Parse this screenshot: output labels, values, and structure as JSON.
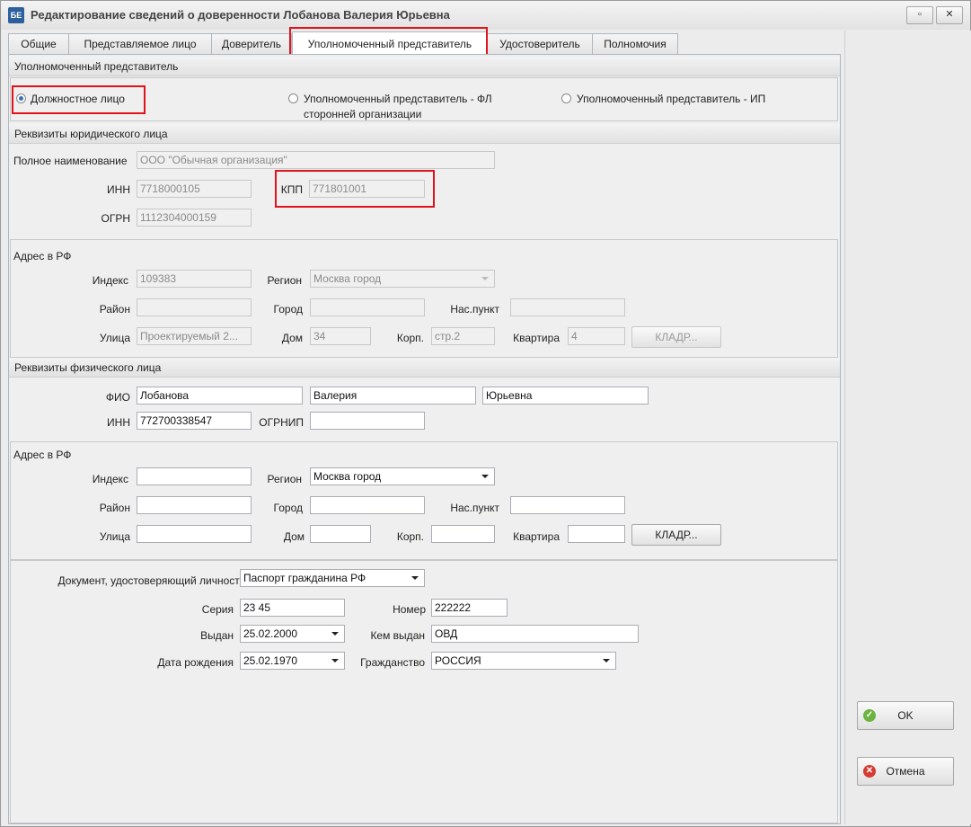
{
  "window": {
    "title": "Редактирование сведений о доверенности Лобанова Валерия Юрьевна",
    "app_icon": "БЕ"
  },
  "tabs": [
    "Общие",
    "Представляемое лицо",
    "Доверитель",
    "Уполномоченный представитель",
    "Удостоверитель",
    "Полномочия"
  ],
  "rep_section": {
    "title": "Уполномоченный представитель",
    "radio1": "Должностное лицо",
    "radio2_line1": "Уполномоченный представитель - ФЛ",
    "radio2_line2": "сторонней организации",
    "radio3": "Уполномоченный представитель - ИП"
  },
  "legal": {
    "title": "Реквизиты юридического лица",
    "fullname_label": "Полное наименование",
    "fullname": "ООО \"Обычная организация\"",
    "inn_label": "ИНН",
    "inn": "7718000105",
    "kpp_label": "КПП",
    "kpp": "771801001",
    "ogrn_label": "ОГРН",
    "ogrn": "1112304000159"
  },
  "addr1": {
    "title": "Адрес в РФ",
    "index_label": "Индекс",
    "index": "109383",
    "region_label": "Регион",
    "region": "Москва город",
    "district_label": "Район",
    "district": "",
    "city_label": "Город",
    "city": "",
    "locality_label": "Нас.пункт",
    "locality": "",
    "street_label": "Улица",
    "street": "Проектируемый 2...",
    "house_label": "Дом",
    "house": "34",
    "building_label": "Корп.",
    "building": "стр.2",
    "apt_label": "Квартира",
    "apt": "4",
    "kladr": "КЛАДР..."
  },
  "physical": {
    "title": "Реквизиты физического лица",
    "fio_label": "ФИО",
    "last": "Лобанова",
    "first": "Валерия",
    "middle": "Юрьевна",
    "inn_label": "ИНН",
    "inn": "772700338547",
    "ogrnip_label": "ОГРНИП",
    "ogrnip": ""
  },
  "addr2": {
    "title": "Адрес в РФ",
    "index_label": "Индекс",
    "index": "",
    "region_label": "Регион",
    "region": "Москва город",
    "district_label": "Район",
    "district": "",
    "city_label": "Город",
    "city": "",
    "locality_label": "Нас.пункт",
    "locality": "",
    "street_label": "Улица",
    "street": "",
    "house_label": "Дом",
    "house": "",
    "building_label": "Корп.",
    "building": "",
    "apt_label": "Квартира",
    "apt": "",
    "kladr": "КЛАДР..."
  },
  "doc": {
    "type_label": "Документ, удостоверяющий личность",
    "type": "Паспорт гражданина РФ",
    "series_label": "Серия",
    "series": "23 45",
    "number_label": "Номер",
    "number": "222222",
    "issued_label": "Выдан",
    "issued": "25.02.2000",
    "issuer_label": "Кем выдан",
    "issuer": "ОВД",
    "birth_label": "Дата рождения",
    "birth": "25.02.1970",
    "citizenship_label": "Гражданство",
    "citizenship": "РОССИЯ"
  },
  "buttons": {
    "ok": "OK",
    "cancel": "Отмена"
  },
  "colors": {
    "highlight": "#e0121c",
    "ok_icon": "#6cb33f",
    "cancel_icon": "#d63a32"
  }
}
